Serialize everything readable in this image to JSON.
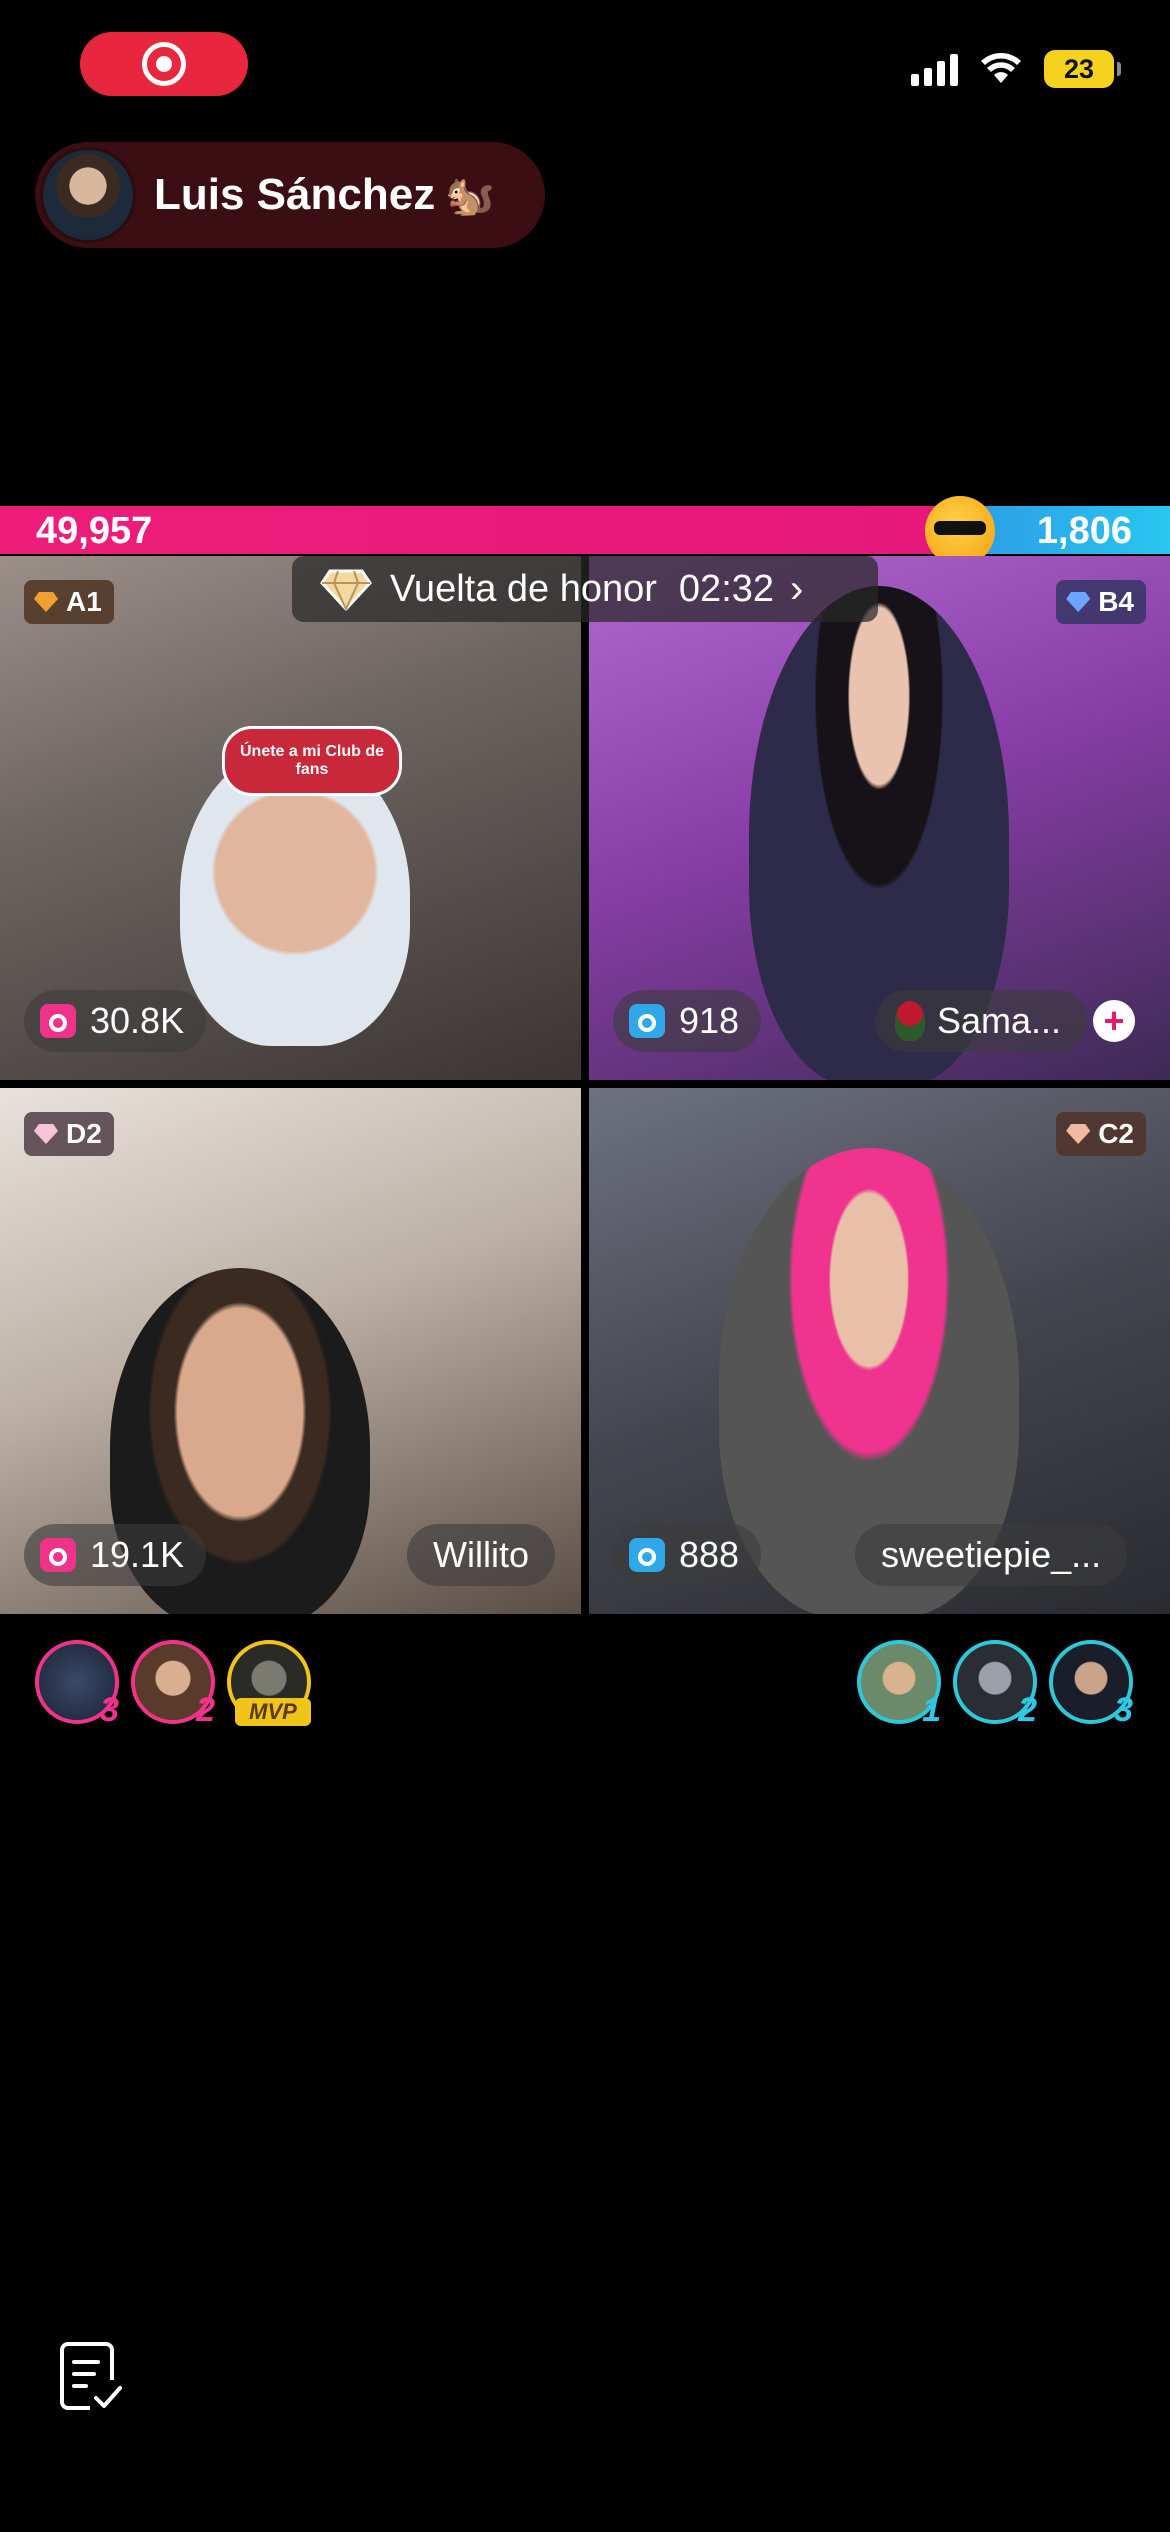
{
  "status_bar": {
    "battery": "23",
    "icons": [
      "screen-record-icon",
      "signal-icon",
      "wifi-icon",
      "battery-charging-icon"
    ]
  },
  "host": {
    "name": "Luis Sánchez",
    "emoji": "🐿️"
  },
  "battle": {
    "left_score": "49,957",
    "right_score": "1,806",
    "honor_label": "Vuelta de honor",
    "honor_time": "02:32"
  },
  "participants": [
    {
      "rank": "A1",
      "score": "30.8K",
      "name": "",
      "team_color": "#f0338a",
      "badge_color": "#e8902a"
    },
    {
      "rank": "B4",
      "score": "918",
      "name": "Sama...",
      "team_color": "#2ea8e8",
      "badge_color": "#6aa6ff"
    },
    {
      "rank": "D2",
      "score": "19.1K",
      "name": "Willito",
      "team_color": "#f0338a",
      "badge_color": "#f5c4d8"
    },
    {
      "rank": "C2",
      "score": "888",
      "name": "sweetiepie_...",
      "team_color": "#2ea8e8",
      "badge_color": "#f0b9a0"
    }
  ],
  "tile_overlays": {
    "fan_club_sticker": "Únete a mi Club de fans"
  },
  "supporters_left": [
    {
      "rank": "3"
    },
    {
      "rank": "2"
    },
    {
      "mvp": "MVP"
    }
  ],
  "supporters_right": [
    {
      "rank": "1"
    },
    {
      "rank": "2"
    },
    {
      "rank": "3"
    }
  ],
  "colors": {
    "red_team": "#e91e7a",
    "blue_team": "#2ab4ec",
    "record": "#e8263d"
  }
}
